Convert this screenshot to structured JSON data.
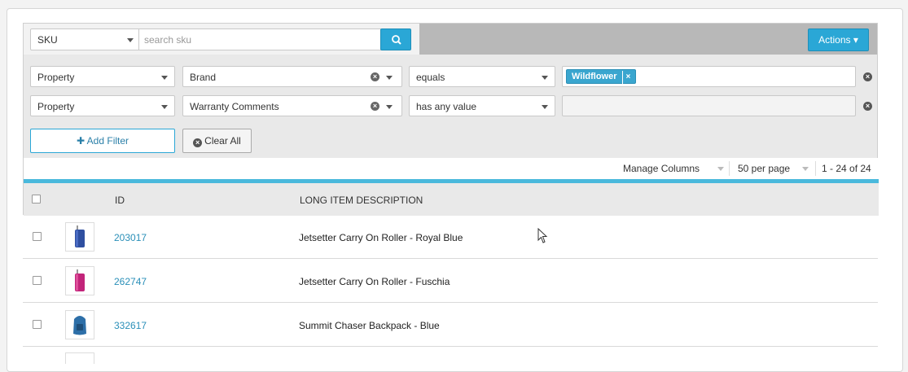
{
  "search": {
    "field": "SKU",
    "placeholder": "search sku",
    "actions_label": "Actions ▾"
  },
  "filters": [
    {
      "type": "Property",
      "field": "Brand",
      "operator": "equals",
      "value_chip": "Wildflower",
      "chip_remove": "×"
    },
    {
      "type": "Property",
      "field": "Warranty Comments",
      "operator": "has any value",
      "value_chip": ""
    }
  ],
  "buttons": {
    "add_filter": "✚ Add Filter",
    "clear_all": "Clear All"
  },
  "pager": {
    "manage_columns": "Manage Columns",
    "per_page": "50 per page",
    "range": "1 - 24 of 24"
  },
  "table": {
    "headers": [
      "ID",
      "LONG ITEM DESCRIPTION"
    ],
    "rows": [
      {
        "id": "203017",
        "description": "Jetsetter Carry On Roller - Royal Blue",
        "thumb_color": "#2f4fa0"
      },
      {
        "id": "262747",
        "description": "Jetsetter Carry On Roller - Fuschia",
        "thumb_color": "#c2247a"
      },
      {
        "id": "332617",
        "description": "Summit Chaser Backpack - Blue",
        "thumb_color": "#2d6fa8"
      }
    ]
  },
  "colors": {
    "accent": "#2aa7d6",
    "link": "#2a8fb8",
    "band": "#4ab9dc"
  }
}
